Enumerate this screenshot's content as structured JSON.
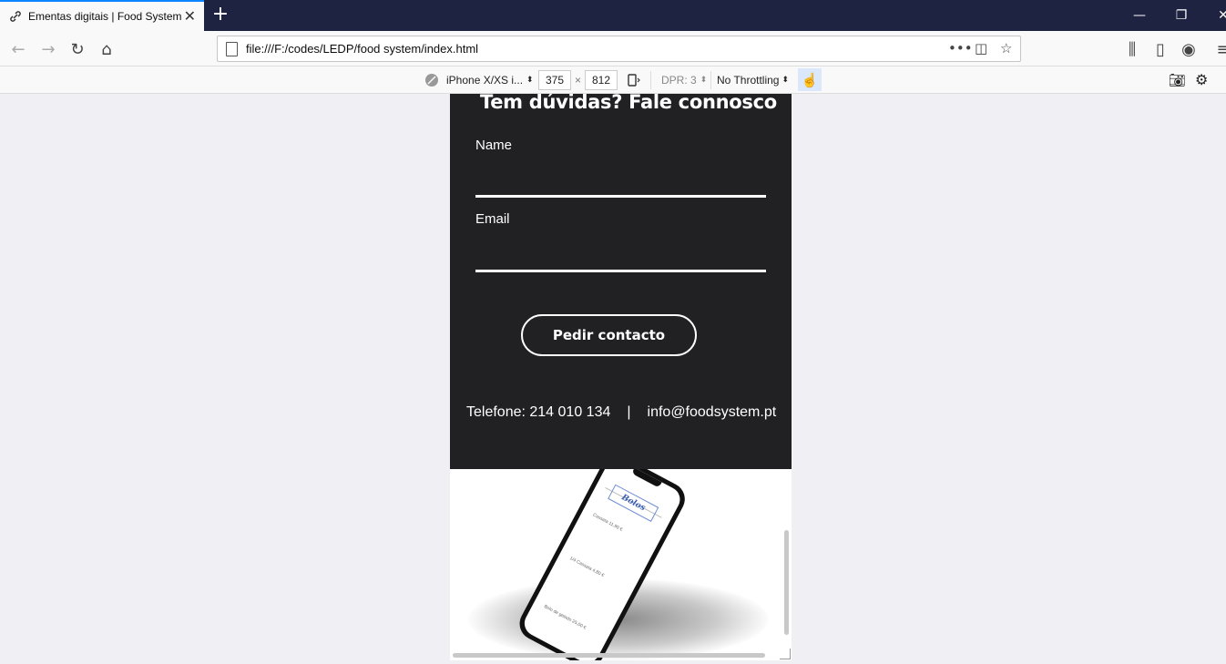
{
  "browser": {
    "tab_title": "Ementas digitais | Food System",
    "url": "file:///F:/codes/LEDP/food system/index.html"
  },
  "rdm": {
    "device": "iPhone X/XS i...",
    "width": "375",
    "times": "×",
    "height": "812",
    "dpr": "DPR: 3",
    "throttling": "No Throttling"
  },
  "page": {
    "heading": "Tem dúvidas? Fale connosco",
    "name_label": "Name",
    "email_label": "Email",
    "cta_label": "Pedir contacto",
    "phone_text": "Telefone: 214 010 134",
    "divider": "|",
    "email_text": "info@foodsystem.pt"
  },
  "mockup": {
    "title": "Bolos",
    "items": [
      "Cassata 11,90 €",
      "1/4 Cassata 4,80 €",
      "Bolo de gelado 25,00 €"
    ]
  },
  "colors": {
    "dark_bg": "#212124",
    "tabbar": "#1f2342",
    "accent": "#0a84ff"
  }
}
